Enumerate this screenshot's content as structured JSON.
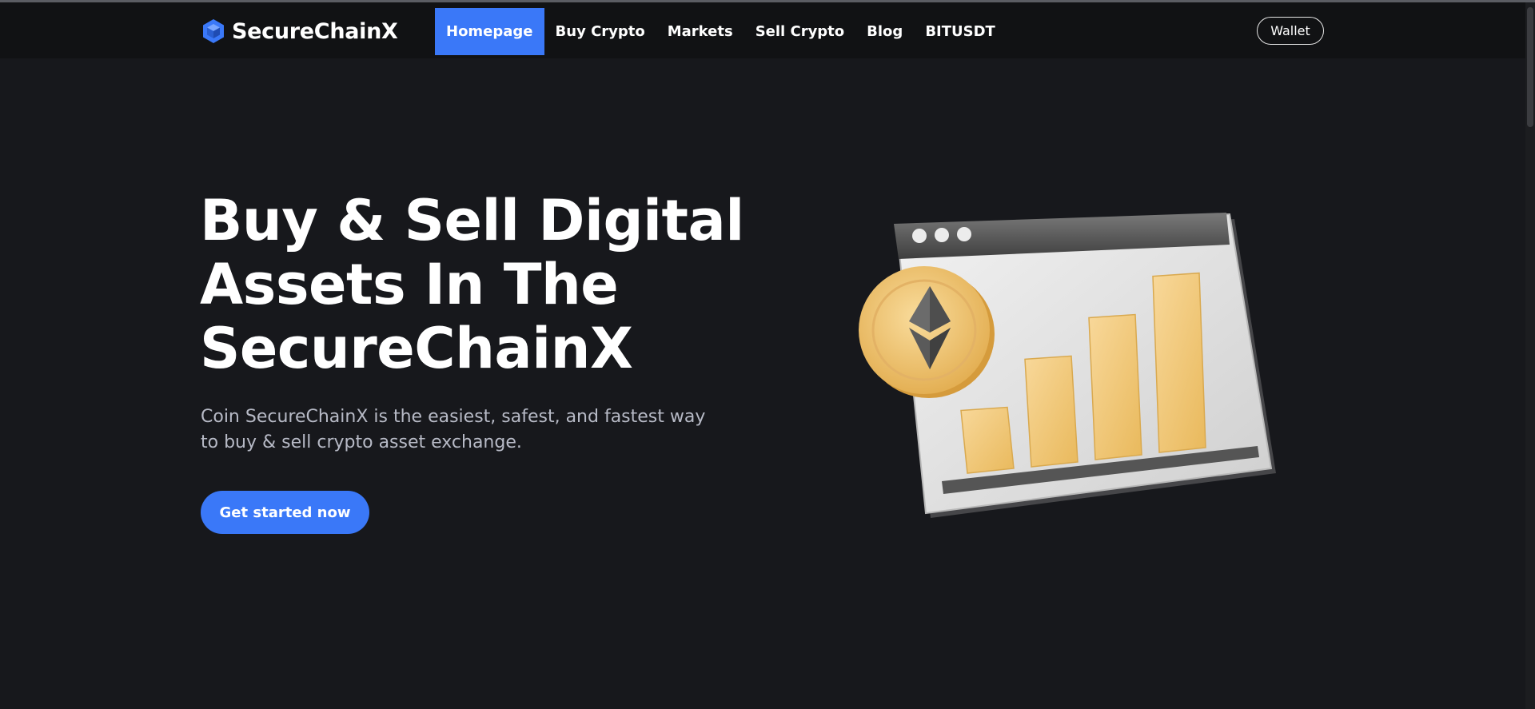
{
  "brand": {
    "name": "SecureChainX",
    "logo_icon": "cube-icon",
    "accent": "#3a78f8"
  },
  "nav": {
    "items": [
      {
        "label": "Homepage",
        "active": true
      },
      {
        "label": "Buy Crypto",
        "active": false
      },
      {
        "label": "Markets",
        "active": false
      },
      {
        "label": "Sell Crypto",
        "active": false
      },
      {
        "label": "Blog",
        "active": false
      },
      {
        "label": "BITUSDT",
        "active": false
      }
    ],
    "wallet_label": "Wallet"
  },
  "hero": {
    "title_lines": [
      "Buy & Sell Digital",
      "Assets In The",
      "SecureChainX"
    ],
    "subtitle": "Coin SecureChainX is the easiest, safest, and fastest way to buy & sell crypto asset exchange.",
    "cta_label": "Get started now",
    "illustration": {
      "icons": [
        "browser-window-icon",
        "ethereum-coin-icon",
        "bar-chart-icon"
      ],
      "bar_levels": [
        0.25,
        0.42,
        0.55,
        0.68
      ]
    }
  },
  "colors": {
    "background": "#17181c",
    "navbar": "#111214",
    "text_muted": "#b7bac6",
    "bar": "#f2c978",
    "coin": "#f0c878"
  }
}
